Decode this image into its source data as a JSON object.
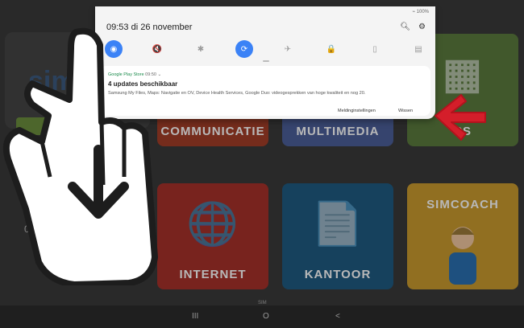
{
  "background": {
    "left_partial_text": "sim",
    "left_partial_times": [
      "0",
      "09"
    ],
    "tiles": [
      {
        "label": "COMMUNICATIE",
        "color": "#a33d28",
        "glyph": ""
      },
      {
        "label": "MULTIMEDIA",
        "color": "#4b5f99",
        "glyph": ""
      },
      {
        "label": "PS",
        "color": "#5b7a3e",
        "glyph": "▦"
      },
      {
        "label": "INTERNET",
        "color": "#a7312a",
        "glyph": "🌐"
      },
      {
        "label": "KANTOOR",
        "color": "#1f5b82",
        "glyph": "📄"
      },
      {
        "label": "SIMCOACH",
        "color": "#c99a2f",
        "glyph": ""
      }
    ],
    "bottom_label": "SIM"
  },
  "notification_panel": {
    "status": "100%",
    "clock": "09:53 di 26 november",
    "top_icons": [
      "search-icon",
      "gear-icon"
    ],
    "quick_settings": [
      {
        "name": "wifi-icon",
        "symbol": "◉",
        "active": true
      },
      {
        "name": "sound-icon",
        "symbol": "🔇",
        "active": false
      },
      {
        "name": "bluetooth-icon",
        "symbol": "✱",
        "active": false
      },
      {
        "name": "auto-rotate-icon",
        "symbol": "⟳",
        "active": true
      },
      {
        "name": "airplane-mode-icon",
        "symbol": "✈",
        "active": false
      },
      {
        "name": "lock-icon",
        "symbol": "🔒",
        "active": false
      },
      {
        "name": "battery-icon",
        "symbol": "▯",
        "active": false
      },
      {
        "name": "folder-icon",
        "symbol": "▤",
        "active": false
      }
    ],
    "notification": {
      "app": "Google Play Store",
      "time": "09:50",
      "title": "4 updates beschikbaar",
      "body": "Samsung My Files, Maps: Navigatie en OV, Device Health Services, Google Duo: videogesprekken van hoge kwaliteit en nog 20.",
      "settings_label": "Meldinginstellingen",
      "clear_label": "Wissen"
    }
  },
  "navbar": {
    "recent": "III",
    "home": "O",
    "back": "<"
  },
  "overlay": {
    "hand_pointer": "pointing-hand-icon",
    "arrow": "down-arrow-icon",
    "red_arrow": "red-arrow-icon"
  }
}
